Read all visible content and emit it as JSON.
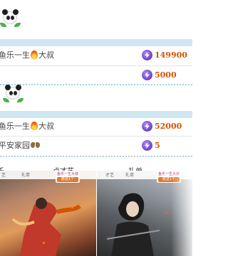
{
  "panel_top": {
    "rows": [
      {
        "name": "鱼乐一生",
        "name_suffix": "大叔",
        "amount": "149900"
      },
      {
        "name": "",
        "name_suffix": "",
        "amount": "5000"
      }
    ]
  },
  "panel_bottom": {
    "rows": [
      {
        "name": "鱼乐一生",
        "name_suffix": "大叔",
        "amount": "52000"
      },
      {
        "name": "平安家园",
        "name_suffix": "",
        "amount": "5"
      }
    ]
  },
  "headers": {
    "col_a": "壬",
    "col_b": "卢才艺",
    "col_c": "礼单"
  },
  "card_left": {
    "tab1": "艺",
    "tab2": "礼单",
    "tag_title": "鱼乐一生大叔",
    "tag_sub": "赠送1个"
  },
  "card_right": {
    "tab1": "才艺",
    "tab2": "礼单",
    "tag_title": "鱼乐一生大叔",
    "tag_sub": "赠送1个"
  },
  "colors": {
    "band": "#cfe6f3",
    "amount": "#d35400",
    "bolt": "#6a3fc8"
  }
}
